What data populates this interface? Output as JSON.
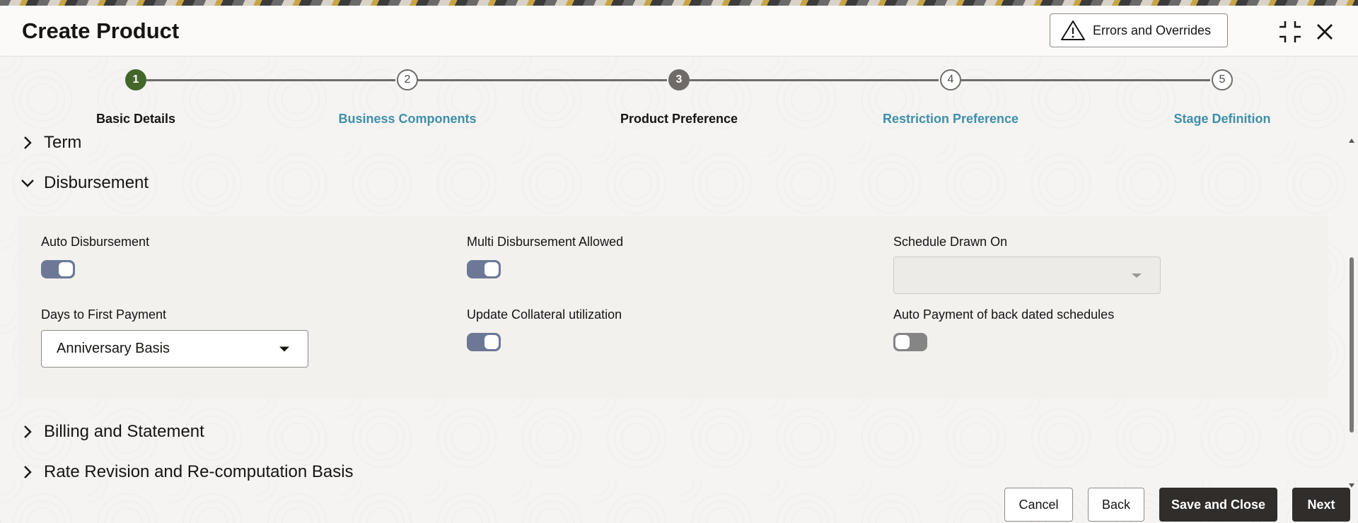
{
  "dialog": {
    "title": "Create Product",
    "errors_button": "Errors and Overrides"
  },
  "train": {
    "steps": [
      {
        "number": "1",
        "label": "Basic Details",
        "state": "completed"
      },
      {
        "number": "2",
        "label": "Business Components",
        "state": "pending"
      },
      {
        "number": "3",
        "label": "Product Preference",
        "state": "current"
      },
      {
        "number": "4",
        "label": "Restriction Preference",
        "state": "pending"
      },
      {
        "number": "5",
        "label": "Stage Definition",
        "state": "pending"
      }
    ]
  },
  "sections": {
    "term": "Term",
    "disbursement": "Disbursement",
    "billing": "Billing and Statement",
    "rate_revision": "Rate Revision and Re-computation Basis"
  },
  "disbursement": {
    "auto_disbursement": {
      "label": "Auto Disbursement",
      "on": true
    },
    "multi_disbursement": {
      "label": "Multi Disbursement Allowed",
      "on": true
    },
    "schedule_drawn_on": {
      "label": "Schedule Drawn On",
      "value": "",
      "disabled": true
    },
    "days_to_first_payment": {
      "label": "Days to First Payment",
      "value": "Anniversary Basis"
    },
    "update_collateral": {
      "label": "Update Collateral utilization",
      "on": true
    },
    "auto_payment_back_dated": {
      "label": "Auto Payment of back dated schedules",
      "on": false
    }
  },
  "footer": {
    "cancel": "Cancel",
    "back": "Back",
    "save_close": "Save and Close",
    "next": "Next"
  },
  "colors": {
    "completed_step": "#45662b",
    "current_step": "#6f6c68",
    "link": "#3f8fab",
    "toggle_on": "#6c7896",
    "toggle_off": "#858585",
    "primary_button": "#312d2a"
  }
}
